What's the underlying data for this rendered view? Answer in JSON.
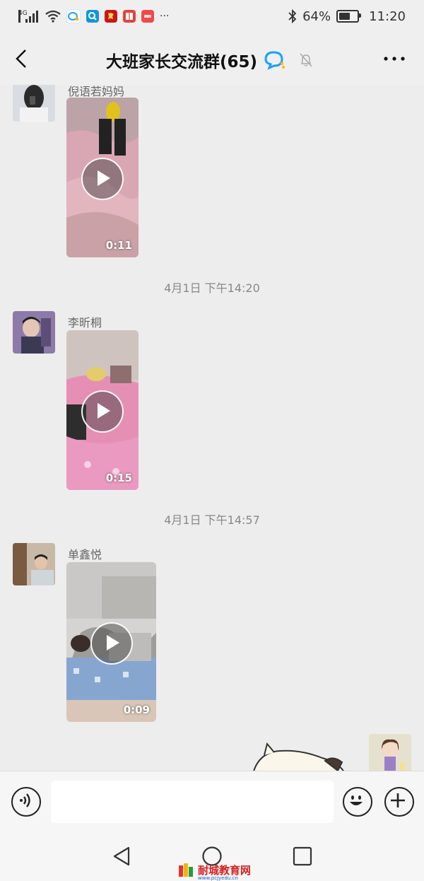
{
  "status_bar": {
    "network_label": "4G",
    "battery_text": "64%",
    "battery_level": 0.64,
    "time": "11:20",
    "app_icons": [
      "qq-icon",
      "search-app-icon",
      "app-red-icon",
      "book-app-icon",
      "huawei-app-icon"
    ],
    "more_text": "···"
  },
  "header": {
    "title": "大班家长交流群(65)",
    "back_icon": "chevron-left-icon",
    "group_icon": "qq-group-icon",
    "mute_icon": "bell-off-icon",
    "more_icon": "more-dots-icon"
  },
  "messages": [
    {
      "sender": "倪语若妈妈",
      "duration": "0:11"
    },
    {
      "timestamp": "4月1日 下午14:20",
      "sender": "李昕桐",
      "duration": "0:15"
    },
    {
      "timestamp": "4月1日 下午14:57",
      "sender": "单鑫悦",
      "duration": "0:09"
    }
  ],
  "input_bar": {
    "voice_icon": "voice-icon",
    "emoji_icon": "emoji-icon",
    "add_icon": "add-icon",
    "placeholder": ""
  },
  "nav_bar": {
    "back": "nav-back-icon",
    "home": "nav-home-icon",
    "recent": "nav-recent-icon"
  },
  "watermark": {
    "text": "耐城教育网",
    "url": "www.pcjyedu.cn"
  },
  "colors": {
    "background": "#ededed",
    "bar": "#efefef",
    "accent": "#1aa0ff"
  }
}
